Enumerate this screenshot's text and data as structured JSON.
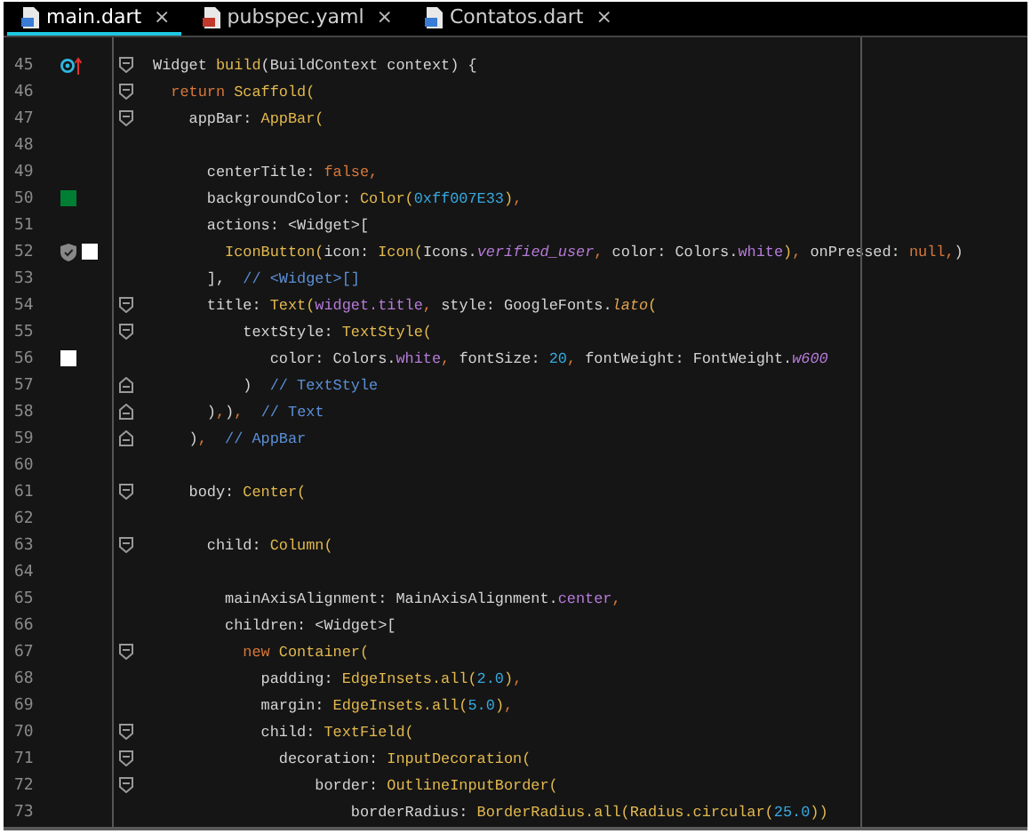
{
  "tabs": [
    {
      "label": "main.dart",
      "selected": true
    },
    {
      "label": "pubspec.yaml",
      "selected": false
    },
    {
      "label": "Contatos.dart",
      "selected": false
    }
  ],
  "close_glyph": "×",
  "lines": [
    {
      "number": "45",
      "fold": {
        "kind": "start"
      },
      "marks": [
        {
          "kind": "override"
        }
      ],
      "tokens": [
        {
          "kind": "plain",
          "text": "Widget "
        },
        {
          "kind": "type",
          "text": "build"
        },
        {
          "kind": "plain",
          "text": "(BuildContext context) {"
        }
      ]
    },
    {
      "number": "46",
      "fold": {
        "kind": "start"
      },
      "tokens": [
        {
          "kind": "keyword",
          "text": "  return "
        },
        {
          "kind": "type",
          "text": "Scaffold("
        }
      ]
    },
    {
      "number": "47",
      "fold": {
        "kind": "start"
      },
      "tokens": [
        {
          "kind": "plain",
          "text": "    appBar: "
        },
        {
          "kind": "type",
          "text": "AppBar("
        }
      ]
    },
    {
      "number": "48"
    },
    {
      "number": "49",
      "tokens": [
        {
          "kind": "plain",
          "text": "      centerTitle: "
        },
        {
          "kind": "keyword",
          "text": "false,"
        }
      ]
    },
    {
      "number": "50",
      "marks": [
        {
          "kind": "swatch",
          "color": "#007e33"
        }
      ],
      "tokens": [
        {
          "kind": "plain",
          "text": "      backgroundColor: "
        },
        {
          "kind": "type",
          "text": "Color("
        },
        {
          "kind": "number",
          "text": "0xff007E33"
        },
        {
          "kind": "type",
          "text": ")"
        },
        {
          "kind": "keyword",
          "text": ","
        }
      ]
    },
    {
      "number": "51",
      "tokens": [
        {
          "kind": "plain",
          "text": "      actions: <Widget>["
        }
      ]
    },
    {
      "number": "52",
      "marks": [
        {
          "kind": "shield"
        },
        {
          "kind": "swatch",
          "color": "#ffffff"
        }
      ],
      "tokens": [
        {
          "kind": "type",
          "text": "        IconButton("
        },
        {
          "kind": "plain",
          "text": "icon: "
        },
        {
          "kind": "type",
          "text": "Icon("
        },
        {
          "kind": "plain",
          "text": "Icons."
        },
        {
          "kind": "member_italic",
          "text": "verified_user"
        },
        {
          "kind": "keyword",
          "text": ", "
        },
        {
          "kind": "plain",
          "text": "color: Colors."
        },
        {
          "kind": "member",
          "text": "white"
        },
        {
          "kind": "type",
          "text": ")"
        },
        {
          "kind": "keyword",
          "text": ", "
        },
        {
          "kind": "plain",
          "text": "onPressed: "
        },
        {
          "kind": "keyword",
          "text": "null,"
        },
        {
          "kind": "plain",
          "text": ")"
        }
      ]
    },
    {
      "number": "53",
      "tokens": [
        {
          "kind": "plain",
          "text": "      ],  "
        },
        {
          "kind": "comment",
          "text": "// <Widget>[]"
        }
      ]
    },
    {
      "number": "54",
      "fold": {
        "kind": "start"
      },
      "tokens": [
        {
          "kind": "plain",
          "text": "      title: "
        },
        {
          "kind": "type",
          "text": "Text("
        },
        {
          "kind": "member",
          "text": "widget.title"
        },
        {
          "kind": "keyword",
          "text": ", "
        },
        {
          "kind": "plain",
          "text": "style: GoogleFonts."
        },
        {
          "kind": "function_italic",
          "text": "lato"
        },
        {
          "kind": "type",
          "text": "("
        }
      ]
    },
    {
      "number": "55",
      "fold": {
        "kind": "start"
      },
      "tokens": [
        {
          "kind": "plain",
          "text": "          textStyle: "
        },
        {
          "kind": "type",
          "text": "TextStyle("
        }
      ]
    },
    {
      "number": "56",
      "marks": [
        {
          "kind": "swatch",
          "color": "#ffffff"
        }
      ],
      "tokens": [
        {
          "kind": "plain",
          "text": "             color: Colors."
        },
        {
          "kind": "member",
          "text": "white"
        },
        {
          "kind": "keyword",
          "text": ", "
        },
        {
          "kind": "plain",
          "text": "fontSize: "
        },
        {
          "kind": "number",
          "text": "20"
        },
        {
          "kind": "keyword",
          "text": ", "
        },
        {
          "kind": "plain",
          "text": "fontWeight: FontWeight."
        },
        {
          "kind": "member_italic",
          "text": "w600"
        }
      ]
    },
    {
      "number": "57",
      "fold": {
        "kind": "end"
      },
      "tokens": [
        {
          "kind": "plain",
          "text": "          )  "
        },
        {
          "kind": "comment",
          "text": "// TextStyle"
        }
      ]
    },
    {
      "number": "58",
      "fold": {
        "kind": "end"
      },
      "tokens": [
        {
          "kind": "plain",
          "text": "      )"
        },
        {
          "kind": "keyword",
          "text": ","
        },
        {
          "kind": "plain",
          "text": ")"
        },
        {
          "kind": "keyword",
          "text": ",  "
        },
        {
          "kind": "comment",
          "text": "// Text"
        }
      ]
    },
    {
      "number": "59",
      "fold": {
        "kind": "end"
      },
      "tokens": [
        {
          "kind": "plain",
          "text": "    )"
        },
        {
          "kind": "keyword",
          "text": ",  "
        },
        {
          "kind": "comment",
          "text": "// AppBar"
        }
      ]
    },
    {
      "number": "60"
    },
    {
      "number": "61",
      "fold": {
        "kind": "start"
      },
      "tokens": [
        {
          "kind": "plain",
          "text": "    body: "
        },
        {
          "kind": "type",
          "text": "Center("
        }
      ]
    },
    {
      "number": "62"
    },
    {
      "number": "63",
      "fold": {
        "kind": "start"
      },
      "tokens": [
        {
          "kind": "plain",
          "text": "      child: "
        },
        {
          "kind": "type",
          "text": "Column("
        }
      ]
    },
    {
      "number": "64"
    },
    {
      "number": "65",
      "tokens": [
        {
          "kind": "plain",
          "text": "        mainAxisAlignment: MainAxisAlignment."
        },
        {
          "kind": "member",
          "text": "center"
        },
        {
          "kind": "keyword",
          "text": ","
        }
      ]
    },
    {
      "number": "66",
      "tokens": [
        {
          "kind": "plain",
          "text": "        children: <Widget>["
        }
      ]
    },
    {
      "number": "67",
      "fold": {
        "kind": "start"
      },
      "tokens": [
        {
          "kind": "keyword",
          "text": "          new "
        },
        {
          "kind": "type",
          "text": "Container("
        }
      ]
    },
    {
      "number": "68",
      "tokens": [
        {
          "kind": "plain",
          "text": "            padding: "
        },
        {
          "kind": "type",
          "text": "EdgeInsets.all("
        },
        {
          "kind": "number",
          "text": "2.0"
        },
        {
          "kind": "type",
          "text": ")"
        },
        {
          "kind": "keyword",
          "text": ","
        }
      ]
    },
    {
      "number": "69",
      "tokens": [
        {
          "kind": "plain",
          "text": "            margin: "
        },
        {
          "kind": "type",
          "text": "EdgeInsets.all("
        },
        {
          "kind": "number",
          "text": "5.0"
        },
        {
          "kind": "type",
          "text": ")"
        },
        {
          "kind": "keyword",
          "text": ","
        }
      ]
    },
    {
      "number": "70",
      "fold": {
        "kind": "start"
      },
      "tokens": [
        {
          "kind": "plain",
          "text": "            child: "
        },
        {
          "kind": "type",
          "text": "TextField("
        }
      ]
    },
    {
      "number": "71",
      "fold": {
        "kind": "start"
      },
      "tokens": [
        {
          "kind": "plain",
          "text": "              decoration: "
        },
        {
          "kind": "type",
          "text": "InputDecoration("
        }
      ]
    },
    {
      "number": "72",
      "fold": {
        "kind": "start"
      },
      "tokens": [
        {
          "kind": "plain",
          "text": "                  border: "
        },
        {
          "kind": "type",
          "text": "OutlineInputBorder("
        }
      ]
    },
    {
      "number": "73",
      "tokens": [
        {
          "kind": "plain",
          "text": "                      borderRadius: "
        },
        {
          "kind": "type",
          "text": "BorderRadius.all(Radius.circular("
        },
        {
          "kind": "number",
          "text": "25.0"
        },
        {
          "kind": "type",
          "text": "))"
        }
      ]
    }
  ]
}
